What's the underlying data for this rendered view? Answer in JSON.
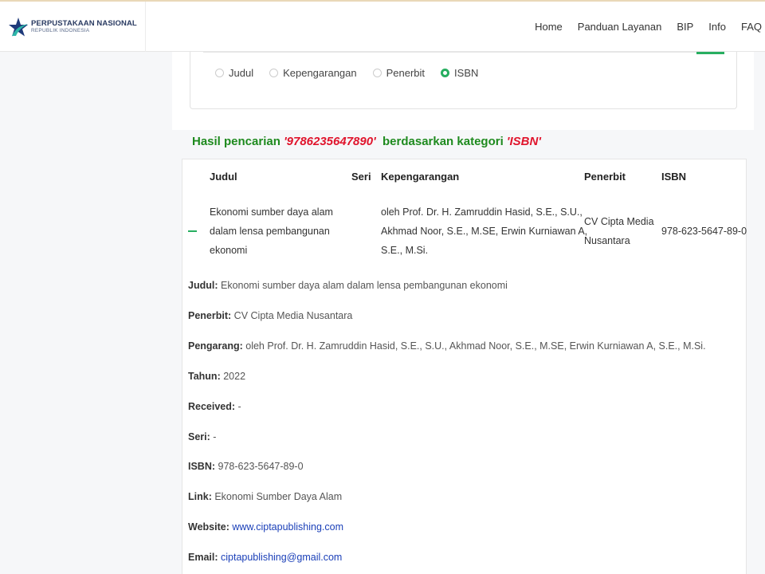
{
  "header": {
    "brand_name": "PERPUSTAKAAN NASIONAL",
    "brand_sub": "REPUBLIK INDONESIA",
    "nav": [
      "Home",
      "Panduan Layanan",
      "BIP",
      "Info",
      "FAQ"
    ]
  },
  "search": {
    "options": [
      {
        "label": "Judul",
        "checked": false
      },
      {
        "label": "Kepengarangan",
        "checked": false
      },
      {
        "label": "Penerbit",
        "checked": false
      },
      {
        "label": "ISBN",
        "checked": true
      }
    ]
  },
  "result": {
    "prefix": "Hasil pencarian",
    "query": "'9786235647890'",
    "middle": "berdasarkan kategori",
    "category": "'ISBN'"
  },
  "table": {
    "headers": {
      "judul": "Judul",
      "seri": "Seri",
      "kepengarangan": "Kepengarangan",
      "penerbit": "Penerbit",
      "isbn": "ISBN"
    },
    "row": {
      "judul": [
        "Ekonomi sumber daya alam",
        "dalam lensa pembangunan",
        "ekonomi"
      ],
      "kepengarangan": [
        "oleh Prof. Dr. H. Zamruddin Hasid, S.E., S.U.,",
        "Akhmad Noor, S.E., M.SE, Erwin Kurniawan A,",
        "S.E., M.Si."
      ],
      "penerbit": [
        "CV Cipta Media",
        "Nusantara"
      ],
      "isbn": "978-623-5647-89-0"
    }
  },
  "details": [
    {
      "label": "Judul:",
      "value": "Ekonomi sumber daya alam dalam lensa pembangunan ekonomi",
      "link": false
    },
    {
      "label": "Penerbit:",
      "value": "CV Cipta Media Nusantara",
      "link": false
    },
    {
      "label": "Pengarang:",
      "value": "oleh Prof. Dr. H. Zamruddin Hasid, S.E., S.U., Akhmad Noor, S.E., M.SE, Erwin Kurniawan A, S.E., M.Si.",
      "link": false
    },
    {
      "label": "Tahun:",
      "value": "2022",
      "link": false
    },
    {
      "label": "Received:",
      "value": "-",
      "link": false
    },
    {
      "label": "Seri:",
      "value": "-",
      "link": false
    },
    {
      "label": "ISBN:",
      "value": "978-623-5647-89-0",
      "link": false
    },
    {
      "label": "Link:",
      "value": "Ekonomi Sumber Daya Alam",
      "link": false
    },
    {
      "label": "Website:",
      "value": "www.ciptapublishing.com",
      "link": true
    },
    {
      "label": "Email:",
      "value": "ciptapublishing@gmail.com",
      "link": true
    }
  ],
  "colors": {
    "accent": "#27ae60",
    "heading": "#1e8a1e",
    "query": "#e0142c",
    "link": "#1a3fb8"
  }
}
